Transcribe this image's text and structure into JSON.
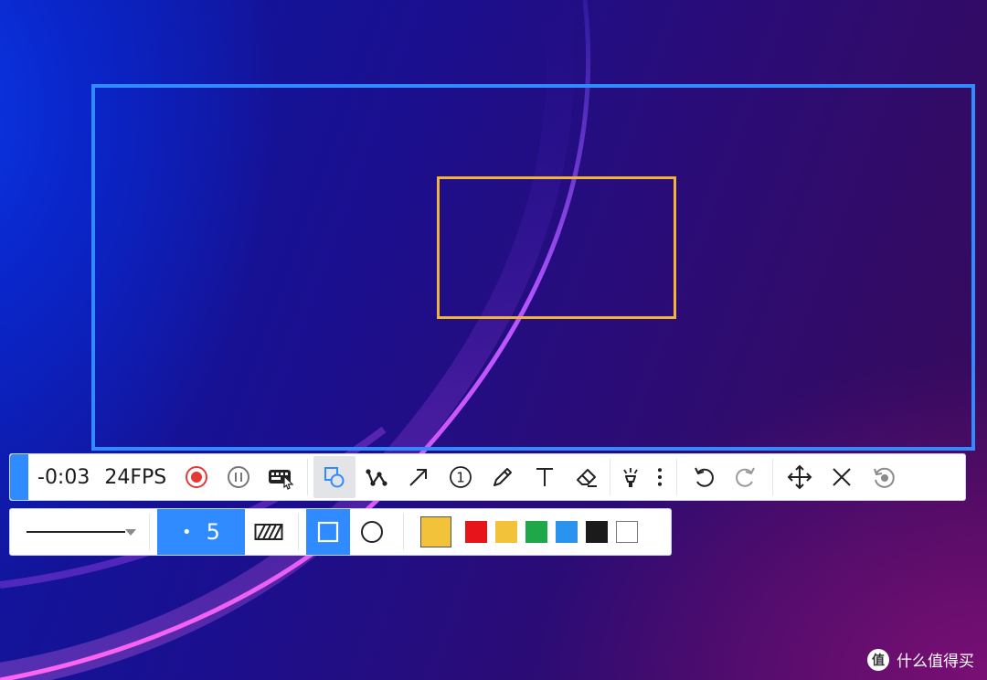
{
  "recording": {
    "timer": "-0:03",
    "fps": "24FPS"
  },
  "colors": {
    "accent": "#2f8bff",
    "selection_border": "#2f8bff",
    "annotation_rect": "#f2b33a",
    "record_red": "#e53935",
    "current_color": "#f2c23a"
  },
  "toolbar": {
    "icons": [
      "record-icon",
      "pause-icon",
      "keyboard-mouse-icon",
      "shape-tool-icon",
      "polyline-icon",
      "arrow-icon",
      "step-number-icon",
      "pencil-icon",
      "text-icon",
      "eraser-icon",
      "highlighter-icon",
      "more-icon",
      "undo-icon",
      "redo-icon",
      "move-icon",
      "close-icon",
      "reset-icon"
    ],
    "step_number": "1"
  },
  "options": {
    "line_style": "solid",
    "size": "5",
    "fill": "hatched",
    "shape_selected": "rectangle",
    "palette": [
      "#e8141c",
      "#f2c23a",
      "#1fa84a",
      "#2a93ee",
      "#1b1b1b",
      "#ffffff"
    ]
  },
  "watermark": {
    "logo": "值",
    "text": "什么值得买"
  }
}
